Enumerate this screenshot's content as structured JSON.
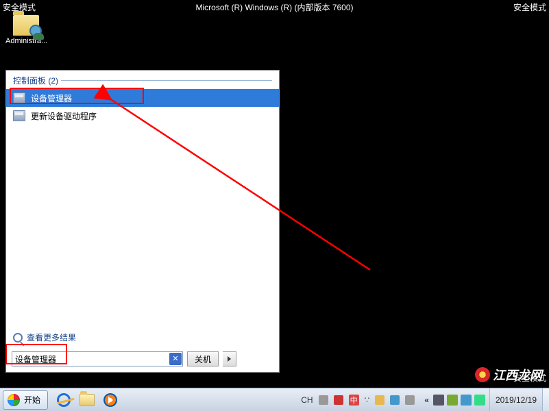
{
  "safe_mode_label": "安全模式",
  "top_title": "Microsoft (R) Windows (R) (内部版本 7600)",
  "desktop": {
    "icon_label": "Administra..."
  },
  "start_menu": {
    "header_label": "控制面板 (2)",
    "items": [
      {
        "label": "设备管理器"
      },
      {
        "label": "更新设备驱动程序"
      }
    ],
    "more_results": "查看更多结果",
    "search_value": "设备管理器",
    "shutdown_label": "关机"
  },
  "taskbar": {
    "start_label": "开始",
    "lang_prefix": "CH",
    "ime_text": "中",
    "date": "2019/12/19"
  },
  "watermark_text": "江西龙网"
}
